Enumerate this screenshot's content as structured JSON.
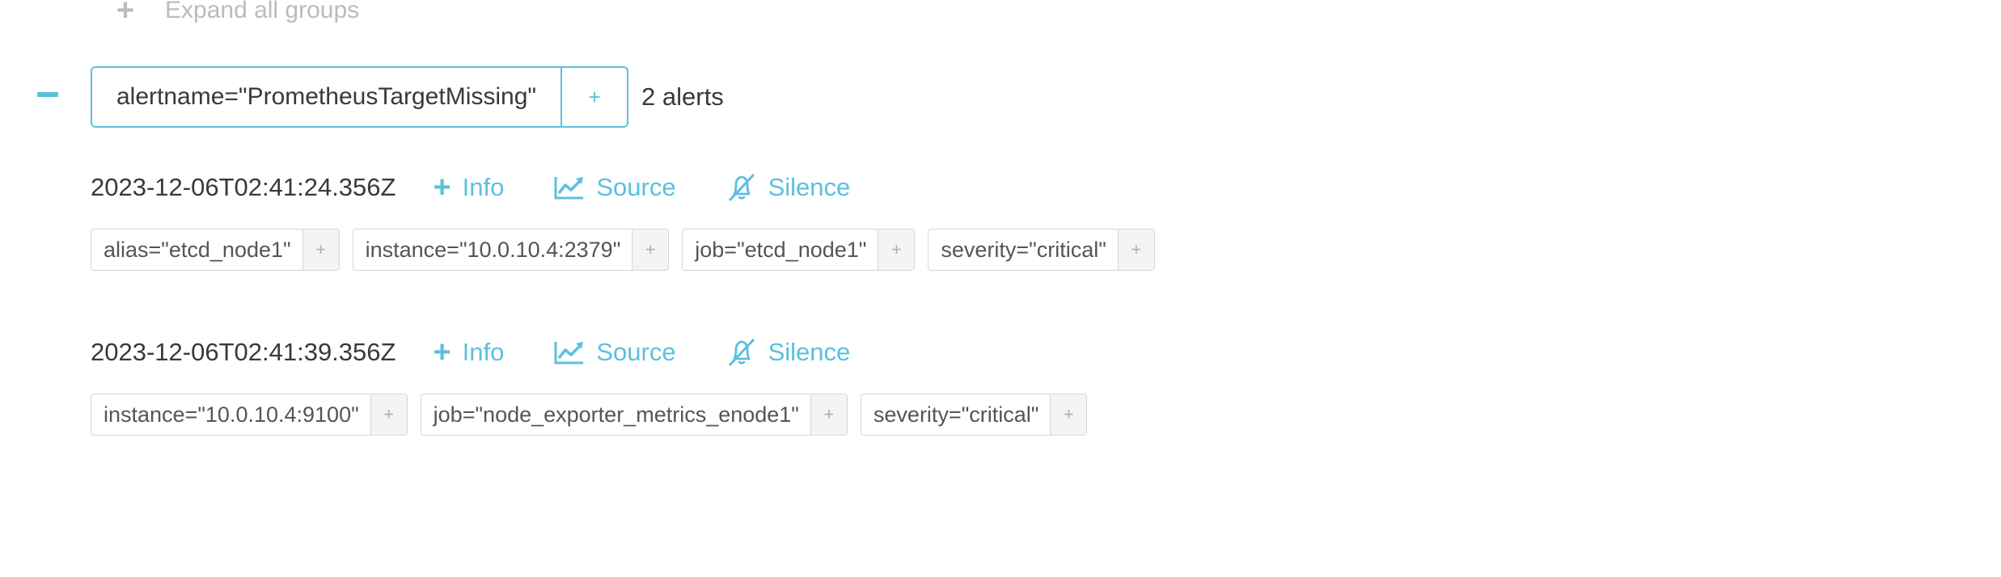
{
  "expand_all": {
    "icon": "plus-icon",
    "label": "Expand all groups"
  },
  "group": {
    "matcher": "alertname=\"PrometheusTargetMissing\"",
    "matcher_add_label": "+",
    "count_label": "2 alerts"
  },
  "alerts": [
    {
      "timestamp": "2023-12-06T02:41:24.356Z",
      "actions": {
        "info": "Info",
        "source": "Source",
        "silence": "Silence"
      },
      "labels": [
        {
          "text": "alias=\"etcd_node1\"",
          "add": "+"
        },
        {
          "text": "instance=\"10.0.10.4:2379\"",
          "add": "+"
        },
        {
          "text": "job=\"etcd_node1\"",
          "add": "+"
        },
        {
          "text": "severity=\"critical\"",
          "add": "+"
        }
      ]
    },
    {
      "timestamp": "2023-12-06T02:41:39.356Z",
      "actions": {
        "info": "Info",
        "source": "Source",
        "silence": "Silence"
      },
      "labels": [
        {
          "text": "instance=\"10.0.10.4:9100\"",
          "add": "+"
        },
        {
          "text": "job=\"node_exporter_metrics_enode1\"",
          "add": "+"
        },
        {
          "text": "severity=\"critical\"",
          "add": "+"
        }
      ]
    }
  ],
  "colors": {
    "accent": "#5bc0de",
    "muted": "#b9bcbf",
    "text": "#373a3c",
    "border": "#d6d6d6"
  }
}
